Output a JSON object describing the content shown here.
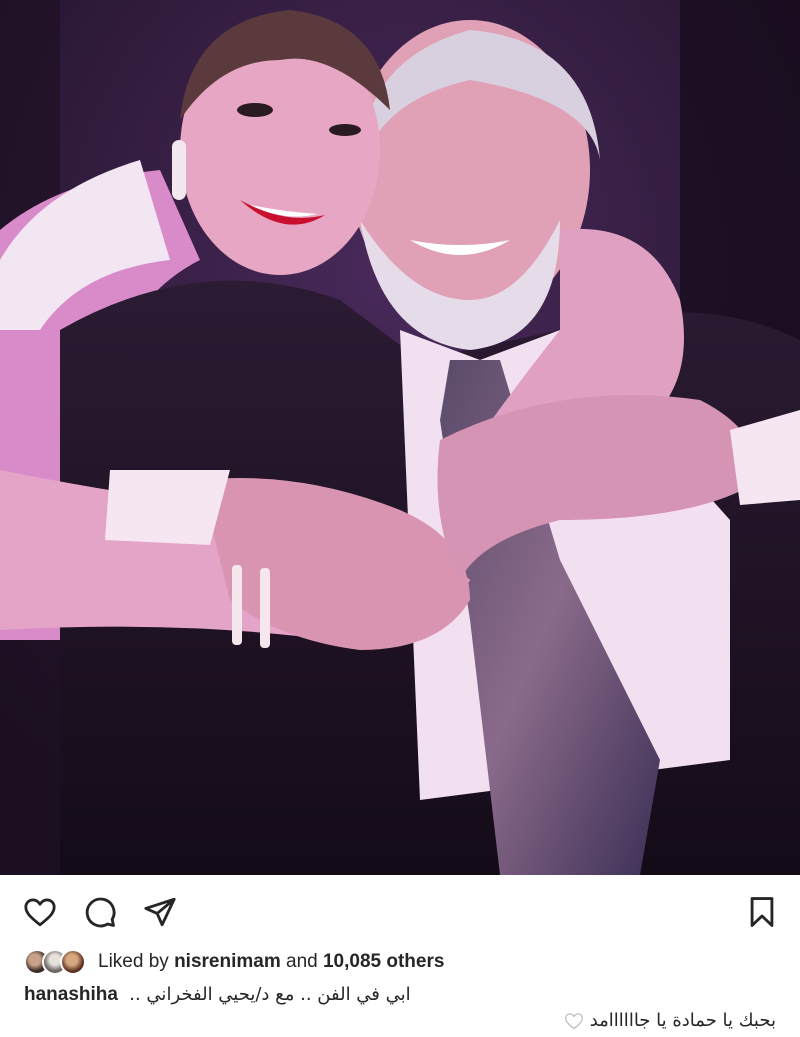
{
  "post": {
    "photo": {
      "description_icon": "photo-image"
    },
    "actions": {
      "like_icon": "heart-icon",
      "comment_icon": "comment-icon",
      "share_icon": "paper-plane-icon",
      "save_icon": "bookmark-icon"
    },
    "likes": {
      "prefix": "Liked by",
      "user": "nisrenimam",
      "joiner": "and",
      "others": "10,085 others"
    },
    "caption": {
      "username": "hanashiha",
      "text": "ابي في الفن .. مع د/يحيي الفخراني .."
    },
    "comment": {
      "text": "بحبك يا حمادة يا جاااااامد",
      "emoji_icon": "white-heart-icon"
    }
  }
}
